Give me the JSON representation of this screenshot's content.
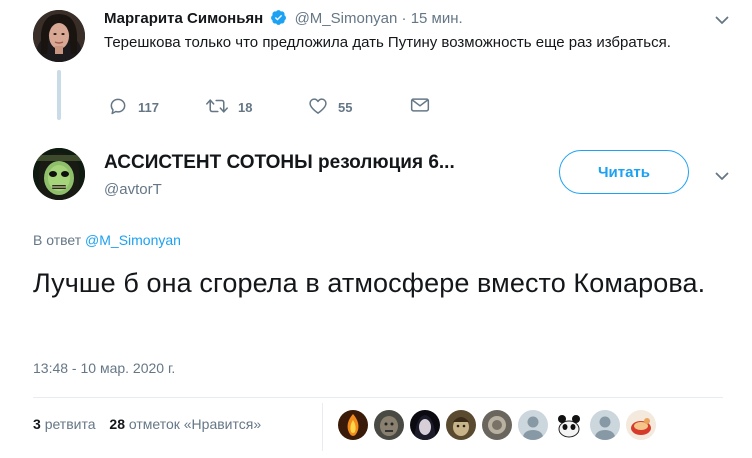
{
  "parent_tweet": {
    "author_name": "Маргарита Симоньян",
    "handle": "@M_Simonyan",
    "separator": "·",
    "time": "15 мин.",
    "text": "Терешкова только что предложила дать Путину возможность еще раз избраться.",
    "actions": {
      "replies": "117",
      "retweets": "18",
      "likes": "55"
    }
  },
  "reply_tweet": {
    "author_name": "АССИСТЕНТ СОТОНЫ резолюция 6...",
    "handle": "@avtorT",
    "follow_label": "Читать",
    "reply_prefix": "В ответ",
    "reply_to_handle": "@M_Simonyan",
    "text": "Лучше б она сгорела в атмосфере вместо Комарова.",
    "timestamp": "13:48 - 10 мар. 2020 г.",
    "stats": {
      "retweets_count": "3",
      "retweets_label": "ретвита",
      "likes_count": "28",
      "likes_label": "отметок «Нравится»"
    }
  },
  "icons": {
    "verified": "verified-badge-icon",
    "chevron": "chevron-down-icon",
    "reply": "reply-icon",
    "retweet": "retweet-icon",
    "like": "heart-icon",
    "dm": "envelope-icon"
  },
  "colors": {
    "accent": "#1da1f2",
    "muted": "#657786",
    "text": "#14171a",
    "thread_line": "#c8dbe6"
  }
}
